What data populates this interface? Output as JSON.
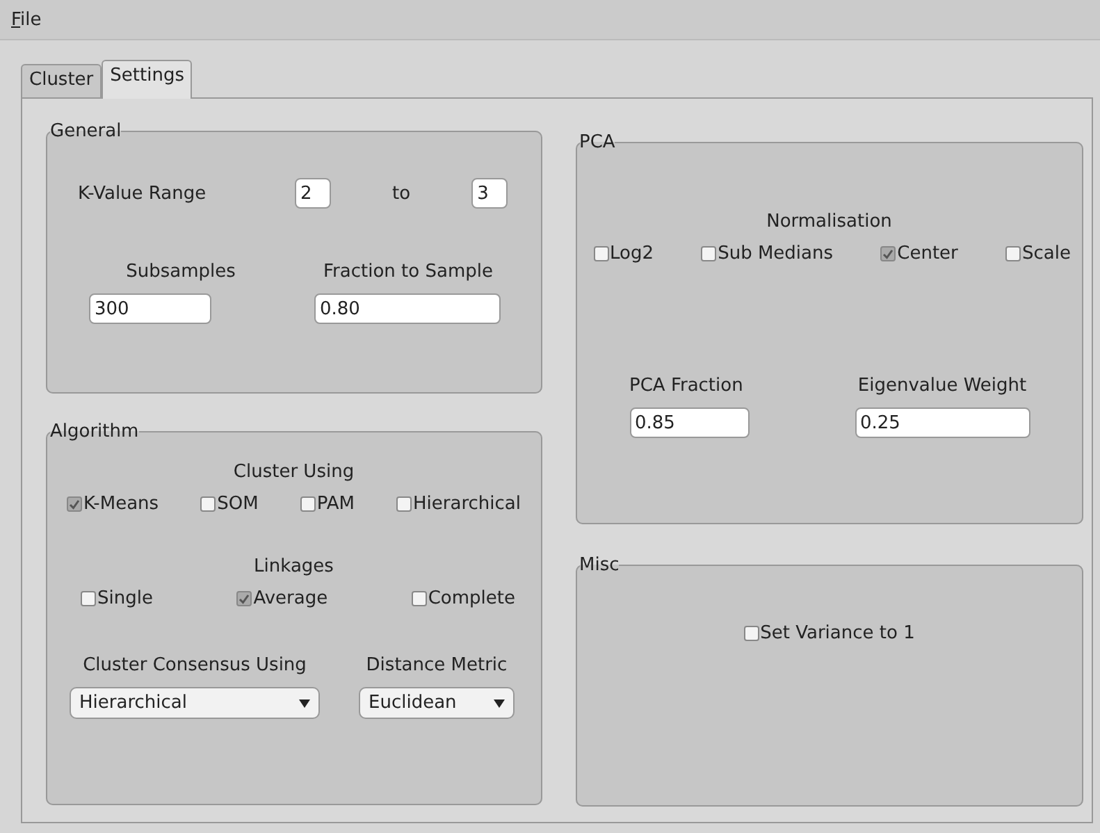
{
  "menu": [
    {
      "label": "File"
    }
  ],
  "tabs": [
    {
      "label": "Cluster",
      "selected": false
    },
    {
      "label": "Settings",
      "selected": true
    }
  ],
  "general": {
    "title": "General",
    "k_range": {
      "label": "K-Value Range",
      "from": "2",
      "separator": "to",
      "to": "3"
    },
    "fields": [
      {
        "label": "Subsamples",
        "value": "300"
      },
      {
        "label": "Fraction to Sample",
        "value": "0.80"
      }
    ]
  },
  "algorithm": {
    "title": "Algorithm",
    "groups": [
      {
        "label": "Cluster Using",
        "options": [
          {
            "label": "K-Means",
            "checked": true
          },
          {
            "label": "SOM",
            "checked": false
          },
          {
            "label": "PAM",
            "checked": false
          },
          {
            "label": "Hierarchical",
            "checked": false
          }
        ]
      },
      {
        "label": "Linkages",
        "options": [
          {
            "label": "Single",
            "checked": false
          },
          {
            "label": "Average",
            "checked": true
          },
          {
            "label": "Complete",
            "checked": false
          }
        ]
      }
    ],
    "selects": [
      {
        "label": "Cluster Consensus Using",
        "value": "Hierarchical"
      },
      {
        "label": "Distance Metric",
        "value": "Euclidean"
      }
    ]
  },
  "pca": {
    "title": "PCA",
    "groups": [
      {
        "label": "Normalisation",
        "options": [
          {
            "label": "Log2",
            "checked": false
          },
          {
            "label": "Sub Medians",
            "checked": false
          },
          {
            "label": "Center",
            "checked": true
          },
          {
            "label": "Scale",
            "checked": false
          }
        ]
      }
    ],
    "fields": [
      {
        "label": "PCA Fraction",
        "value": "0.85"
      },
      {
        "label": "Eigenvalue Weight",
        "value": "0.25"
      }
    ]
  },
  "misc": {
    "title": "Misc",
    "options": [
      {
        "label": "Set Variance to 1",
        "checked": false
      }
    ]
  }
}
